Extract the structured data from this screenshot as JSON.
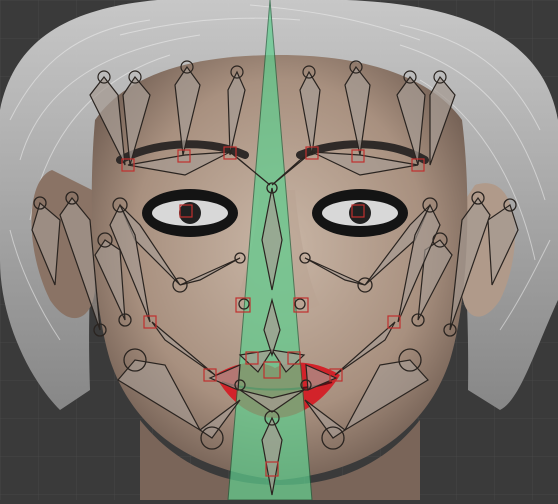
{
  "viewport": {
    "background": "#3a3a3a",
    "grid_color": "#474747",
    "label": ""
  },
  "colors": {
    "skin_light": "#c9b6a6",
    "skin_mid": "#a8907f",
    "skin_shadow": "#6d5a4f",
    "hair": "#d9d9d9",
    "hair_shadow": "#8b8b8b",
    "bone_fill": "#a69b93",
    "bone_stroke": "#2a2420",
    "center_bone": "#5fcf8f",
    "joint_box": "#c0302e",
    "lip_red": "#d2232a"
  },
  "icons": {
    "bone": "bone-shape",
    "joint": "joint-circle",
    "handle": "bone-handle-box"
  }
}
